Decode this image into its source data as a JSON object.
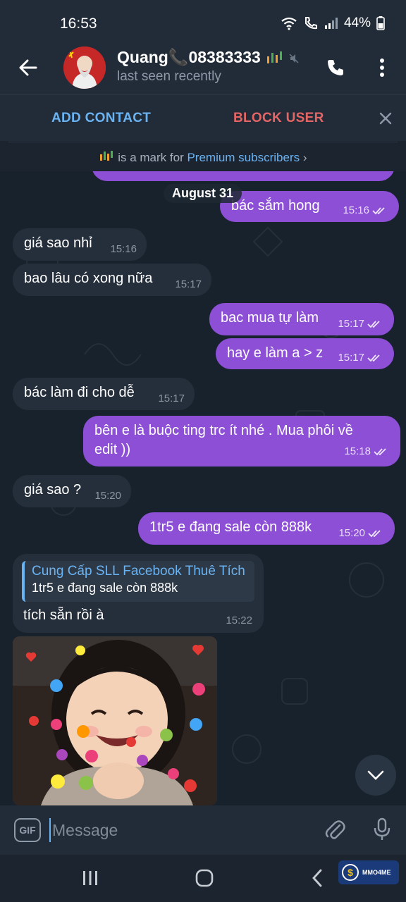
{
  "status_bar": {
    "time": "16:53",
    "battery": "44%"
  },
  "header": {
    "name": "Quang📞08383333",
    "status": "last seen recently"
  },
  "actions": {
    "add_contact": "ADD CONTACT",
    "block_user": "BLOCK USER"
  },
  "premium_notice": {
    "text": " is a mark for ",
    "link": "Premium subscribers",
    "chevron": "›"
  },
  "chat": {
    "date_chip": "August 31",
    "messages": [
      {
        "dir": "out",
        "text": "bác sắm hong",
        "time": "15:16"
      },
      {
        "dir": "in",
        "text": "giá sao nhỉ",
        "time": "15:16"
      },
      {
        "dir": "in",
        "text": "bao lâu có xong nữa",
        "time": "15:17"
      },
      {
        "dir": "out",
        "text": "bac mua tự làm",
        "time": "15:17"
      },
      {
        "dir": "out",
        "text": "hay e làm a > z",
        "time": "15:17"
      },
      {
        "dir": "in",
        "text": "bác làm đi cho dễ",
        "time": "15:17"
      },
      {
        "dir": "out",
        "text_line1": "bên e là buộc ting trc ít nhé . Mua phôi về",
        "text_line2": "edit ))",
        "time": "15:18"
      },
      {
        "dir": "in",
        "text": "giá sao ?",
        "time": "15:20"
      },
      {
        "dir": "out",
        "text": "1tr5 e đang sale còn 888k",
        "time": "15:20"
      }
    ],
    "reply": {
      "quote_title": "Cung Cấp SLL Facebook Thuê Tích",
      "quote_text": "1tr5 e đang sale còn 888k",
      "text": "tích sẵn rồi à",
      "time": "15:22"
    }
  },
  "composer": {
    "gif_label": "GIF",
    "placeholder": "Message"
  },
  "watermark": {
    "text": "MMO4ME"
  },
  "colors": {
    "outgoing": "#8c4fd6",
    "incoming": "#252f3b",
    "link": "#6ab3f3",
    "danger": "#e56565"
  }
}
